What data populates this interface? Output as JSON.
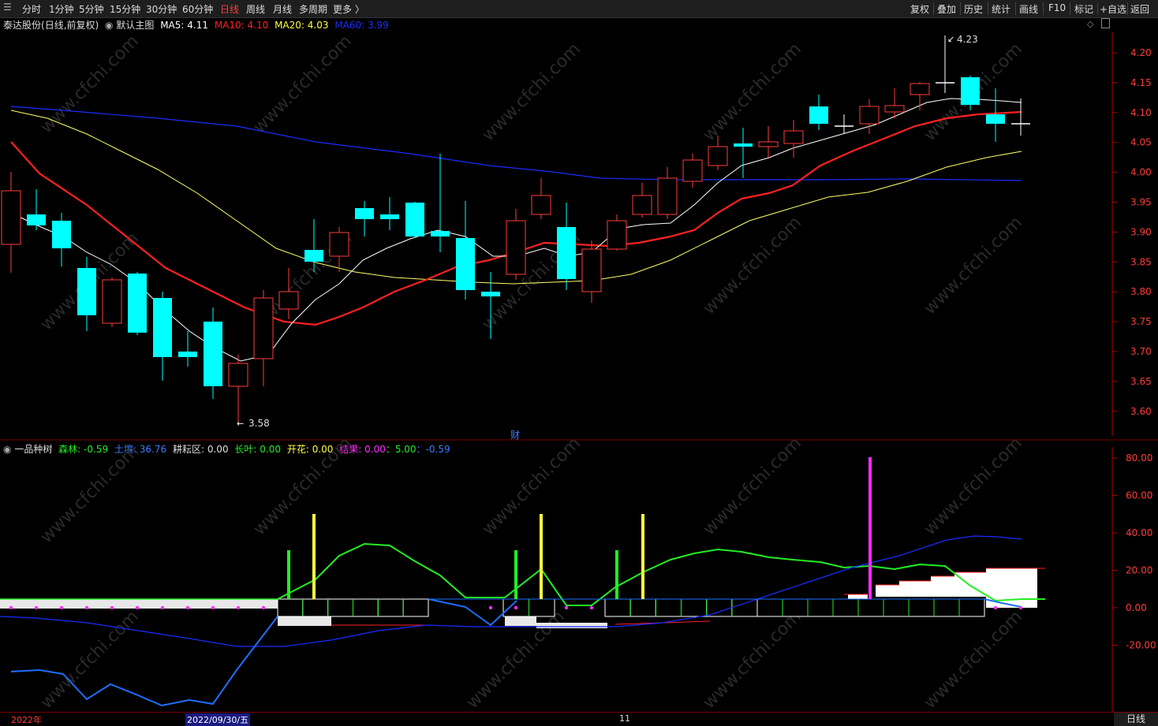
{
  "toolbar": {
    "periods": [
      "分时",
      "1分钟",
      "5分钟",
      "15分钟",
      "30分钟",
      "60分钟",
      "日线",
      "周线",
      "月线",
      "多周期",
      "更多 〉"
    ],
    "active_index": 6,
    "actions": [
      "复权",
      "叠加",
      "历史",
      "统计",
      "画线",
      "F10",
      "标记",
      "+自选",
      "返回"
    ]
  },
  "main": {
    "stock": "泰达股份",
    "mode": "(日线,前复权)",
    "template": "默认主图",
    "ma5": {
      "label": "MA5:",
      "value": "4.11",
      "color": "#ffffff"
    },
    "ma10": {
      "label": "MA10:",
      "value": "4.10",
      "color": "#ff2020"
    },
    "ma20": {
      "label": "MA20:",
      "value": "4.03",
      "color": "#ffff40"
    },
    "ma60": {
      "label": "MA60:",
      "value": "3.99",
      "color": "#1a2cff"
    },
    "price_axis": [
      "4.20",
      "4.15",
      "4.10",
      "4.05",
      "4.00",
      "3.95",
      "3.90",
      "3.85",
      "3.80",
      "3.75",
      "3.70",
      "3.65",
      "3.60"
    ],
    "high_label": "4.23",
    "low_label": "3.58",
    "fin_marker": "财"
  },
  "indicator": {
    "name": "一品种树",
    "items": [
      {
        "label": "森林:",
        "value": "-0.59",
        "color": "#22ee22"
      },
      {
        "label": "土壤:",
        "value": "36.76",
        "color": "#3c7dff"
      },
      {
        "label": "耕耘区:",
        "value": "0.00",
        "color": "#dddddd"
      },
      {
        "label": "长叶:",
        "value": "0.00",
        "color": "#22ee22"
      },
      {
        "label": "开花:",
        "value": "0.00",
        "color": "#ffff40"
      },
      {
        "label": "结果:",
        "value": "0.00",
        "color": "#ff2cff"
      }
    ],
    "extra": [
      {
        "text": "：5.00",
        "color": "#22ee22"
      },
      {
        "text": "：-0.59",
        "color": "#3c7dff"
      }
    ],
    "axis": [
      "80.00",
      "60.00",
      "40.00",
      "20.00",
      "0.00",
      "-20.00"
    ]
  },
  "bottom": {
    "dates": [
      "2022年",
      "2022/09/30/五",
      "11"
    ],
    "period": "日线"
  },
  "watermark": "www.cfchi.com",
  "colors": {
    "up": "#ff3b3b",
    "down": "#00ffff",
    "axis": "#b00000"
  }
}
